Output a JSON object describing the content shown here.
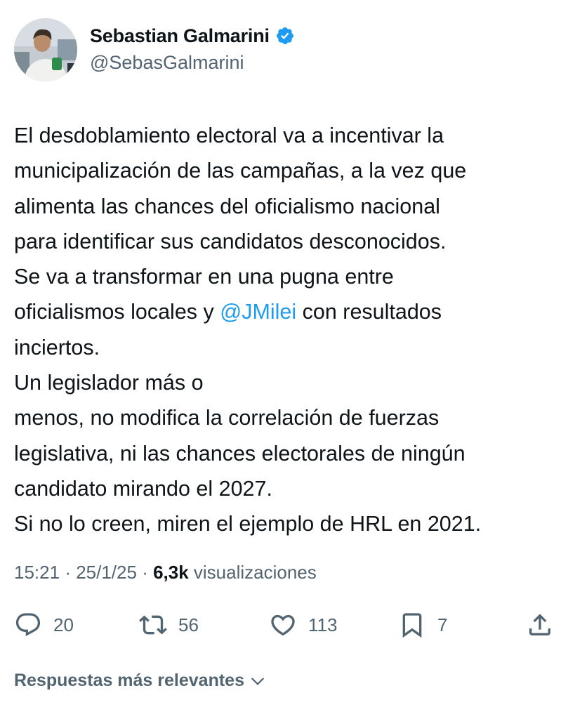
{
  "author": {
    "display_name": "Sebastian Galmarini",
    "handle": "@SebasGalmarini",
    "verified_icon": "verified-badge-icon",
    "avatar": "profile-photo"
  },
  "tweet": {
    "lines": [
      [
        {
          "text": "El desdoblamiento electoral va a incentivar la"
        }
      ],
      [
        {
          "text": "municipalización de las campañas, a la vez que"
        }
      ],
      [
        {
          "text": "alimenta las chances del oficialismo nacional"
        }
      ],
      [
        {
          "text": "para identificar sus candidatos desconocidos."
        }
      ],
      [
        {
          "text": "Se va a transformar en una pugna entre"
        }
      ],
      [
        {
          "text": "oficialismos locales y "
        },
        {
          "text": "@JMilei",
          "mention": true
        },
        {
          "text": " con resultados"
        }
      ],
      [
        {
          "text": "inciertos."
        }
      ],
      [
        {
          "text": "Un legislador más o"
        }
      ],
      [
        {
          "text": "menos, no modifica la correlación de fuerzas"
        }
      ],
      [
        {
          "text": "legislativa, ni las chances electorales de ningún"
        }
      ],
      [
        {
          "text": "candidato mirando el 2027."
        }
      ],
      [
        {
          "text": "Si no lo creen, miren el ejemplo de HRL en 2021."
        }
      ]
    ]
  },
  "meta": {
    "time": "15:21",
    "date": "25/1/25",
    "separator": "·",
    "views_count": "6,3k",
    "views_label": "visualizaciones"
  },
  "actions": {
    "replies": {
      "icon": "reply-icon",
      "count": "20"
    },
    "retweets": {
      "icon": "retweet-icon",
      "count": "56"
    },
    "likes": {
      "icon": "heart-icon",
      "count": "113"
    },
    "bookmarks": {
      "icon": "bookmark-icon",
      "count": "7"
    },
    "share": {
      "icon": "share-icon"
    }
  },
  "replies_sort": {
    "label": "Respuestas más relevantes",
    "icon": "chevron-down-icon"
  },
  "colors": {
    "text": "#0f1419",
    "secondary": "#536471",
    "link": "#1d9bf0",
    "verified": "#1d9bf0"
  }
}
